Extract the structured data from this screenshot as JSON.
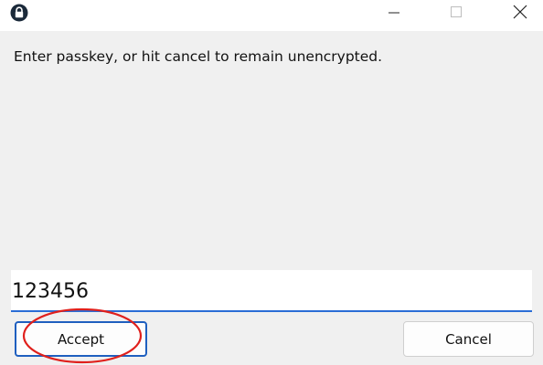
{
  "window": {
    "icon": "lock-icon",
    "controls": {
      "minimize_icon": "minimize-icon",
      "maximize_icon": "maximize-icon",
      "close_icon": "close-icon"
    }
  },
  "dialog": {
    "prompt": "Enter passkey, or hit cancel to remain unencrypted.",
    "passkey_value": "123456",
    "accept_label": "Accept",
    "cancel_label": "Cancel"
  },
  "annotation": {
    "shape": "circle",
    "target": "accept-button",
    "color": "#e0201c"
  },
  "colors": {
    "focus_underline": "#2a6dd6",
    "accept_border": "#1f5fbf"
  }
}
